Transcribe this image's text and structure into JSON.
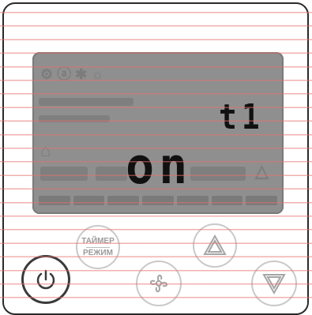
{
  "display": {
    "timer_code": "t1",
    "status": "on"
  },
  "buttons": {
    "power_icon": "power-icon",
    "mode_line1": "ТАЙМЕР",
    "mode_line2": "РЕЖИМ",
    "up_icon": "triangle-up-icon",
    "fan_icon": "fan-icon",
    "down_icon": "triangle-down-icon"
  },
  "colors": {
    "lcd_background": "#8f8f8f",
    "stripe": "#e86e6e",
    "segment": "#111111"
  }
}
